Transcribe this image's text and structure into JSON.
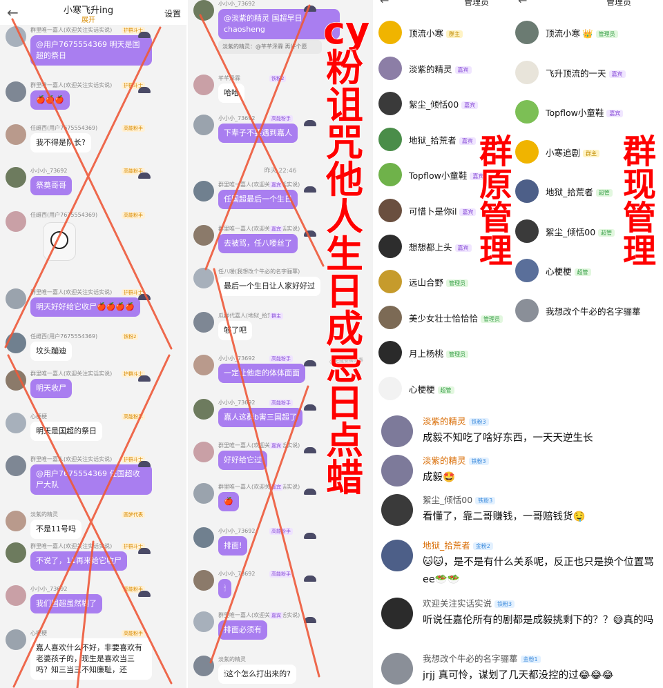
{
  "left_panel": {
    "title": "小寒飞升ing",
    "subtitle": "展开",
    "settings": "设置",
    "messages": [
      {
        "name": "群里唯一嘉人(欢迎关注实话实说)",
        "badge": "护群斗士",
        "text": "@用户7675554369 明天是国超的祭日",
        "style": "purple"
      },
      {
        "name": "群里唯一嘉人(欢迎关注实话实说)",
        "badge": "护群斗士",
        "text": "🍎🍎🍎",
        "style": "purple"
      },
      {
        "name": "任雌西(用户7675554369)",
        "badge": "高能粉手",
        "text": "我不得是队长?",
        "style": "white"
      },
      {
        "name": "小小小_73692",
        "badge": "高能粉手",
        "text": "祭奠哥哥",
        "style": "purple"
      },
      {
        "name": "任雌西(用户7675554369)",
        "badge": "高能粉手",
        "text": "",
        "style": "sticker"
      },
      {
        "name": "群里唯一嘉人(欢迎关注实话实说)",
        "badge": "护群斗士",
        "text": "明天好好给它收尸🍎🍎🍎🍎",
        "style": "purple"
      },
      {
        "name": "任雌西(用户7675554369)",
        "badge": "铁粉2",
        "text": "坟头蹦迪",
        "style": "white"
      },
      {
        "name": "群里唯一嘉人(欢迎关注实话实说)",
        "badge": "护群斗士",
        "text": "明天收尸",
        "style": "purple"
      },
      {
        "name": "心梗梗",
        "badge": "高能粉手",
        "text": "明天是国超的祭日",
        "style": "white"
      },
      {
        "name": "群里唯一嘉人(欢迎关注实话实说)",
        "badge": "护群斗士",
        "text": "@用户7675554369 任国超收尸大队",
        "style": "purple"
      },
      {
        "name": "淡紫的精灵",
        "badge": "圆梦代表",
        "text": "不是11号吗",
        "style": "white"
      },
      {
        "name": "群里唯一嘉人(欢迎关注实话实说)",
        "badge": "护群斗士",
        "text": "不说了，11再来给它收尸",
        "style": "purple"
      },
      {
        "name": "小小小_73692",
        "badge": "高能粉手",
        "text": "我们国超虽然糊了",
        "style": "purple"
      },
      {
        "name": "心梗梗",
        "badge": "高能粉手",
        "text": "嘉人喜欢什么不好，非要喜欢有老婆孩子的，现生是喜欢当三吗？知三当三不知廉耻，还",
        "style": "white"
      }
    ]
  },
  "middle_panel": {
    "time": "昨天 22:46",
    "watermark": "@无缝瓷窖的春",
    "messages": [
      {
        "name": "小小小_73692",
        "badge": "",
        "text": "@淡紫的精灵 国超早日chaosheng",
        "style": "purple",
        "quote": "淡紫的精灵：@芊芊泽霖 再许个愿"
      },
      {
        "name": "芊芊泽霖",
        "badge": "铁粉2",
        "text": "哈哈",
        "style": "white",
        "quote": ""
      },
      {
        "name": "小小小_73692",
        "badge": "高能粉手",
        "text": "下辈子不要遇到嘉人",
        "style": "purple",
        "quote": ""
      },
      {
        "name": "群里唯一嘉人(欢迎关注实话实说)",
        "badge": "嘉宾",
        "text": "任国超最后一个生日",
        "style": "purple",
        "quote": ""
      },
      {
        "name": "群里唯一嘉人(欢迎关注实话实说)",
        "badge": "嘉宾",
        "text": "去被骂，任八喽丝了",
        "style": "purple",
        "quote": ""
      },
      {
        "name": "任八喽(我想改个牛必的名字骊蕐)",
        "badge": "",
        "text": "最后一个生日让人家好好过",
        "style": "white",
        "quote": ""
      },
      {
        "name": "瓜群代嘉人(地狱_拾荒者)",
        "badge": "群主",
        "text": "够了吧",
        "style": "white",
        "quote": ""
      },
      {
        "name": "小小小_73692",
        "badge": "高能粉手",
        "text": "一定让他走的体体面面",
        "style": "purple",
        "quote": ""
      },
      {
        "name": "小小小_73692",
        "badge": "高能粉手",
        "text": "嘉人这群b害三国超了",
        "style": "purple",
        "quote": ""
      },
      {
        "name": "群里唯一嘉人(欢迎关注实话实说)",
        "badge": "嘉宾",
        "text": "好好给它过",
        "style": "purple",
        "quote": ""
      },
      {
        "name": "群里唯一嘉人(欢迎关注实话实说)",
        "badge": "嘉宾",
        "text": "🍎",
        "style": "purple",
        "quote": ""
      },
      {
        "name": "小小小_73692",
        "badge": "高能粉手",
        "text": "排面!",
        "style": "purple",
        "quote": ""
      },
      {
        "name": "小小小_73692",
        "badge": "高能粉手",
        "text": "🕯",
        "style": "purple",
        "quote": ""
      },
      {
        "name": "群里唯一嘉人(欢迎关注实话实说)",
        "badge": "嘉宾",
        "text": "排面必须有",
        "style": "purple",
        "quote": ""
      },
      {
        "name": "淡紫的精灵",
        "badge": "",
        "text": "🕯这个怎么打出来的?",
        "style": "white",
        "quote": ""
      }
    ]
  },
  "right_panel": {
    "header_left": "管理员",
    "header_right": "管理员",
    "original_admins": [
      {
        "name": "顶流小寒",
        "role": "群主",
        "role_type": "group",
        "color": "#f0b400"
      },
      {
        "name": "淡紫的精灵",
        "role": "嘉宾",
        "role_type": "guest",
        "color": "#8c7ea6"
      },
      {
        "name": "絮尘_倾恬00",
        "role": "嘉宾",
        "role_type": "guest",
        "color": "#3a3a3a"
      },
      {
        "name": "地狱_拾荒者",
        "role": "嘉宾",
        "role_type": "guest",
        "color": "#4a8d49"
      },
      {
        "name": "Topflow小童鞋",
        "role": "嘉宾",
        "role_type": "guest",
        "color": "#6fb24a"
      },
      {
        "name": "可惜卜是你il",
        "role": "嘉宾",
        "role_type": "guest",
        "color": "#6a4f3f"
      },
      {
        "name": "想想都上头",
        "role": "嘉宾",
        "role_type": "guest",
        "color": "#2d2d2d"
      },
      {
        "name": "远山合野",
        "role": "管理员",
        "role_type": "admin",
        "color": "#c69b2c"
      },
      {
        "name": "美少女壮士恰恰恰",
        "role": "管理员",
        "role_type": "admin",
        "color": "#7c6a55"
      },
      {
        "name": "月上杨桃",
        "role": "管理员",
        "role_type": "admin",
        "color": "#2a2a2a"
      },
      {
        "name": "心梗梗",
        "role": "超管",
        "role_type": "super",
        "color": "#f2f2f2"
      }
    ],
    "current_admins": [
      {
        "name": "顶流小寒",
        "role": "管理员",
        "role_type": "admin",
        "crown": "👑",
        "color": "#6b7b72"
      },
      {
        "name": "飞升顶流的一天",
        "role": "嘉宾",
        "role_type": "guest",
        "color": "#e8e4da"
      },
      {
        "name": "Topflow小童鞋",
        "role": "嘉宾",
        "role_type": "guest",
        "color": "#7cbf55"
      },
      {
        "name": "小寒追剧",
        "role": "群主",
        "role_type": "group",
        "color": "#f0b400"
      },
      {
        "name": "地狱_拾荒者",
        "role": "超管",
        "role_type": "super",
        "color": "#4d5f88"
      },
      {
        "name": "絮尘_倾恬00",
        "role": "超管",
        "role_type": "super",
        "color": "#3a3a3a"
      },
      {
        "name": "心梗梗",
        "role": "超管",
        "role_type": "super",
        "color": "#5a6f9a"
      },
      {
        "name": "我想改个牛必的名字骊蕐",
        "role": "",
        "role_type": "",
        "color": "#8a8f98"
      }
    ],
    "comments": [
      {
        "name": "淡紫的精灵",
        "name_color": "#d86a00",
        "level": "铁粉3",
        "text": "成毅不知吃了啥好东西，一天天逆生长",
        "color": "#7d7a9a"
      },
      {
        "name": "淡紫的精灵",
        "name_color": "#d86a00",
        "level": "铁粉3",
        "text": "成毅🤩",
        "color": "#7d7a9a"
      },
      {
        "name": "絮尘_倾恬00",
        "name_color": "#555555",
        "level": "铁粉3",
        "text": "看懂了，靠二哥赚钱，一哥赔钱货🤤",
        "color": "#3a3a3a"
      },
      {
        "name": "地狱_拾荒者",
        "name_color": "#d86a00",
        "level": "金粉2",
        "text": "🐱🐱，是不是有什么关系呢，反正也只是换个位置骂ee🥗🥗",
        "color": "#4d5f88"
      },
      {
        "name": "欢迎关注实话实说",
        "name_color": "#555555",
        "level": "铁粉3",
        "text": "听说任嘉伦所有的剧都是成毅挑剩下的？？😅真的吗",
        "color": "#2b2b2b"
      },
      {
        "name": "我想改个牛必的名字骊蕐",
        "name_color": "#555555",
        "level": "金粉1",
        "text": "jrjj 真可怜，谋划了几天都没控的过😂😂😂",
        "color": "#8a8f98"
      }
    ]
  },
  "overlays": {
    "cy_text": "cy粉诅咒他人生日成忌日点蜡",
    "original_admin_label": "群原管理",
    "current_admin_label": "群现管理",
    "accent": "#ff0000"
  }
}
